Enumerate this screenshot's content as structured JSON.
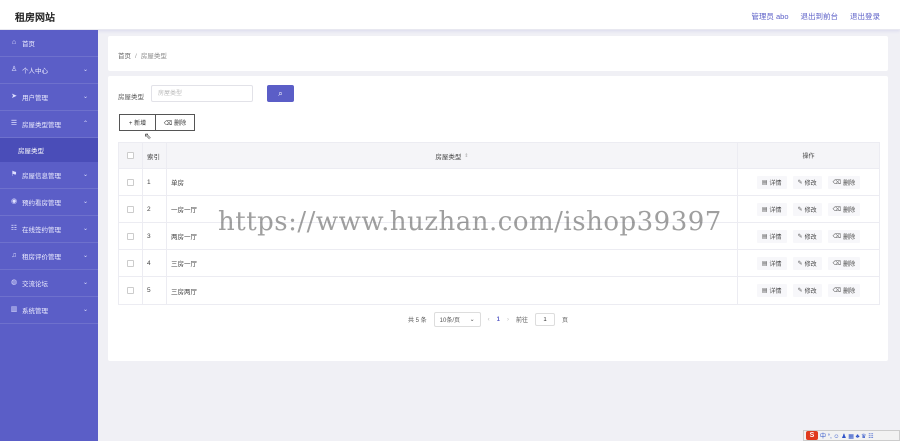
{
  "header": {
    "brand": "租房网站",
    "nav": [
      "管理员 abo",
      "退出到前台",
      "退出登录"
    ]
  },
  "sidebar": {
    "items": [
      {
        "label": "首页",
        "icon": "home-icon",
        "glyph": "⌂",
        "chevron": false
      },
      {
        "label": "个人中心",
        "icon": "user-icon",
        "glyph": "♙",
        "chevron": true
      },
      {
        "label": "用户管理",
        "icon": "send-icon",
        "glyph": "➤",
        "chevron": true
      },
      {
        "label": "房屋类型管理",
        "icon": "list-icon",
        "glyph": "☰",
        "chevron": true,
        "expanded": true
      },
      {
        "label": "房屋信息管理",
        "icon": "flag-icon",
        "glyph": "⚑",
        "chevron": true
      },
      {
        "label": "预约看房管理",
        "icon": "pin-icon",
        "glyph": "◉",
        "chevron": true
      },
      {
        "label": "在线签约管理",
        "icon": "grid-icon",
        "glyph": "☷",
        "chevron": true
      },
      {
        "label": "租房评价管理",
        "icon": "bell-icon",
        "glyph": "♫",
        "chevron": true
      },
      {
        "label": "交流论坛",
        "icon": "chat-icon",
        "glyph": "◍",
        "chevron": true
      },
      {
        "label": "系统管理",
        "icon": "chart-icon",
        "glyph": "▥",
        "chevron": true
      }
    ],
    "submenu_label": "房屋类型"
  },
  "breadcrumb": {
    "home": "首页",
    "sep": "/",
    "current": "房屋类型"
  },
  "search": {
    "label": "房屋类型",
    "placeholder": "房屋类型",
    "button_glyph": "⌕"
  },
  "toolbar": {
    "add_label": "+ 新增",
    "delete_label": "⌫ 删除"
  },
  "table": {
    "headers": {
      "index": "索引",
      "type": "房屋类型",
      "ops": "操作"
    },
    "sort_glyph": "⇕",
    "rows": [
      {
        "index": "1",
        "type": "单房"
      },
      {
        "index": "2",
        "type": "一房一厅"
      },
      {
        "index": "3",
        "type": "两房一厅"
      },
      {
        "index": "4",
        "type": "三房一厅"
      },
      {
        "index": "5",
        "type": "三房两厅"
      }
    ],
    "ops": {
      "detail": "详情",
      "edit": "修改",
      "delete": "删除"
    }
  },
  "pagination": {
    "total": "共 5 条",
    "page_size": "10条/页",
    "prev": "‹",
    "current": "1",
    "next": "›",
    "goto_label": "前往",
    "goto_value": "1",
    "page_unit": "页"
  },
  "watermark": "https://www.huzhan.com/ishop39397",
  "tray": {
    "logo": "S",
    "text": "中 °, ☺ ♟ ▦ ♣ ♛ ☷"
  }
}
